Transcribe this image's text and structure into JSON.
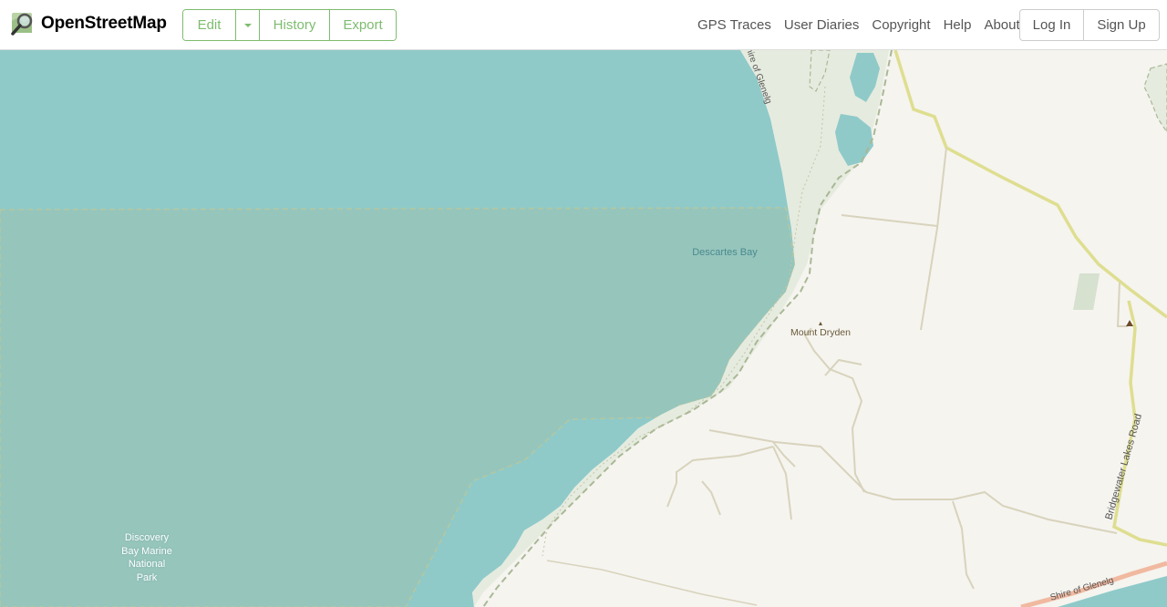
{
  "header": {
    "logo_text": "OpenStreetMap",
    "edit_label": "Edit",
    "history_label": "History",
    "export_label": "Export",
    "nav": [
      "GPS Traces",
      "User Diaries",
      "Copyright",
      "Help",
      "About"
    ],
    "login_label": "Log In",
    "signup_label": "Sign Up"
  },
  "map": {
    "labels": {
      "bay": "Descartes Bay",
      "park_lines": [
        "Discovery",
        "Bay Marine",
        "National",
        "Park"
      ],
      "peak": "Mount Dryden",
      "peak_marker": "▲",
      "road": "Bridgewater Lakes Road",
      "shire_top": "Shire of Glenelg",
      "shire_bottom": "Shire of Glenelg"
    },
    "colors": {
      "sea": "#8fcac9",
      "protected": "#94c6bd",
      "land": "#f5f4ef",
      "scrub": "#e6ebdf",
      "road": "#dede90",
      "track": "#d8d3bc",
      "boundary": "#a9b896"
    },
    "icons": [
      "campsite-icon"
    ]
  }
}
